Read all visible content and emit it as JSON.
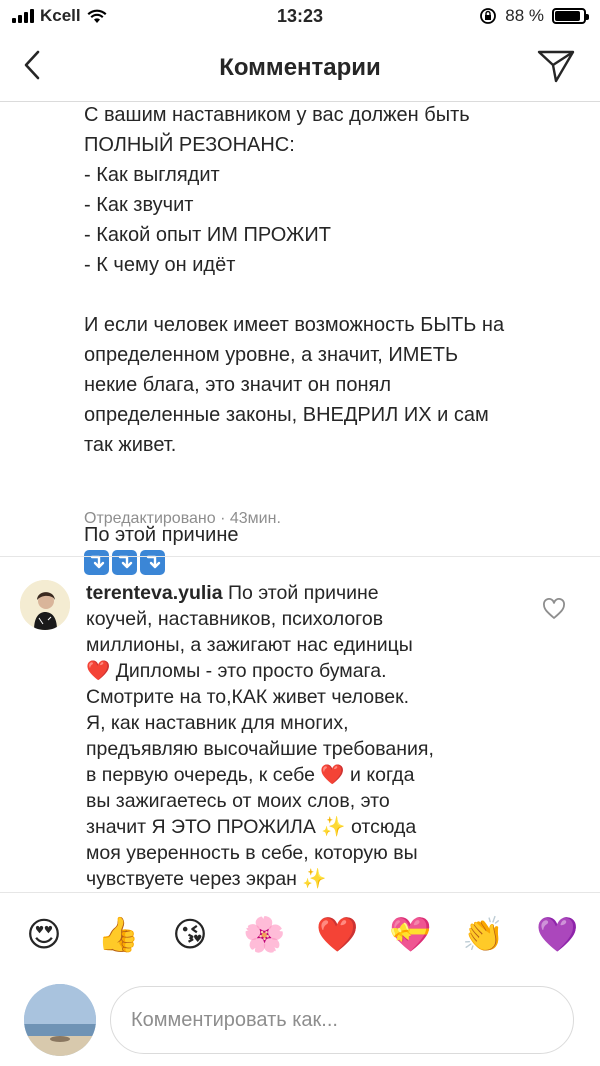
{
  "status_bar": {
    "carrier": "Kcell",
    "time": "13:23",
    "battery": "88 %",
    "battery_level": 0.88
  },
  "header": {
    "title": "Комментарии",
    "back_icon": "chevron-left-icon",
    "share_icon": "paper-plane-icon"
  },
  "caption": {
    "paragraph1": "С вашим наставником у вас должен быть\nПОЛНЫЙ РЕЗОНАНС:\n- Как выглядит\n- Как звучит\n- Какой опыт ИМ ПРОЖИТ\n- К чему он идёт",
    "paragraph2": "И если человек имеет возможность БЫТЬ на\nопределенном уровне, а значит, ИМЕТЬ\nнекие блага, это значит он понял\nопределенные законы, ВНЕДРИЛ ИХ и сам\nтак живет.",
    "paragraph3": "По этой причине",
    "meta": "Отредактировано · 43мин."
  },
  "comment": {
    "username": "terenteva.yulia",
    "part1": " По этой причине\nкоучей, наставников, психологов\nмиллионы, а зажигают нас единицы\n",
    "heart1": "❤️",
    "part2": " Дипломы - это просто бумага.\nСмотрите на то,КАК живет человек.\nЯ, как наставник для многих,\nпредъявляю высочайшие требования,\nв первую очередь, к себе ",
    "heart2": "❤️",
    "part3": " и когда\nвы зажигаетесь от моих слов, это\nзначит Я ЭТО ПРОЖИЛА ",
    "sparkles1": "✨",
    "part4": "  отсюда\nмоя уверенность в себе, которую вы\nчувствуете через экран ",
    "sparkles2": "✨"
  },
  "emoji_bar": [
    "😍",
    "👍",
    "😘",
    "🌸",
    "❤️",
    "💝",
    "👏",
    "💜"
  ],
  "composer": {
    "placeholder": "Комментировать как..."
  }
}
